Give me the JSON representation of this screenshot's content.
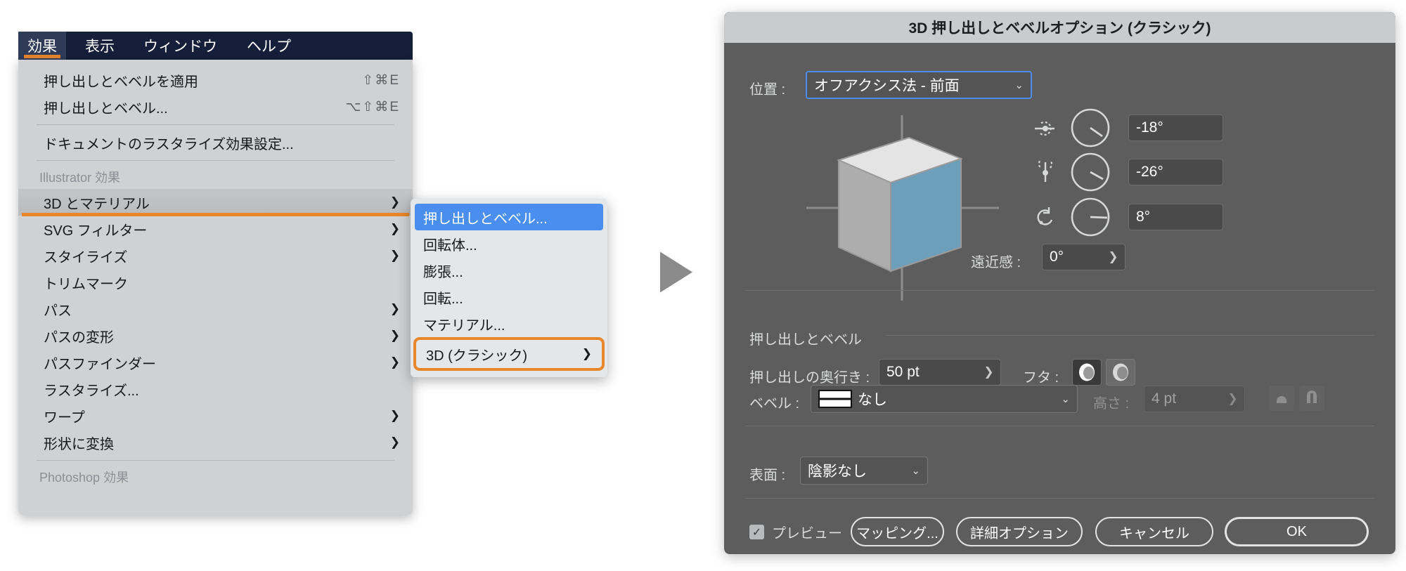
{
  "menu": {
    "bar_items": [
      {
        "label": "効果",
        "active": true
      },
      {
        "label": "表示",
        "active": false
      },
      {
        "label": "ウィンドウ",
        "active": false
      },
      {
        "label": "ヘルプ",
        "active": false
      }
    ],
    "items": [
      {
        "label": "押し出しとベベルを適用",
        "shortcut": "⇧⌘E"
      },
      {
        "label": "押し出しとベベル...",
        "shortcut": "⌥⇧⌘E"
      },
      {
        "label": "ドキュメントのラスタライズ効果設定...",
        "shortcut": ""
      },
      {
        "label": "Illustrator 効果",
        "shortcut": ""
      },
      {
        "label": "3D とマテリアル",
        "shortcut": ""
      },
      {
        "label": "SVG フィルター",
        "shortcut": ""
      },
      {
        "label": "スタイライズ",
        "shortcut": ""
      },
      {
        "label": "トリムマーク",
        "shortcut": ""
      },
      {
        "label": "パス",
        "shortcut": ""
      },
      {
        "label": "パスの変形",
        "shortcut": ""
      },
      {
        "label": "パスファインダー",
        "shortcut": ""
      },
      {
        "label": "ラスタライズ...",
        "shortcut": ""
      },
      {
        "label": "ワープ",
        "shortcut": ""
      },
      {
        "label": "形状に変換",
        "shortcut": ""
      },
      {
        "label": "Photoshop 効果",
        "shortcut": ""
      }
    ],
    "submenu_items": [
      {
        "label": "押し出しとベベル..."
      },
      {
        "label": "回転体..."
      },
      {
        "label": "膨張..."
      },
      {
        "label": "回転..."
      },
      {
        "label": "マテリアル..."
      },
      {
        "label": "3D (クラシック)"
      }
    ],
    "arrow_glyph": "❯",
    "highlight_color": "#e8862b",
    "selection_color": "#4a8ef0"
  },
  "dialog": {
    "title": "3D 押し出しとベベルオプション (クラシック)",
    "position": {
      "label": "位置 :",
      "value": "オフアクシス法 - 前面"
    },
    "angles": [
      {
        "icon": "rotate-x-icon",
        "value": "-18°",
        "dial_deg": 125
      },
      {
        "icon": "rotate-y-icon",
        "value": "-26°",
        "dial_deg": 118
      },
      {
        "icon": "rotate-z-icon",
        "value": "8°",
        "dial_deg": 92
      }
    ],
    "perspective": {
      "label": "遠近感 :",
      "value": "0°",
      "stepper": "❯"
    },
    "extrude_section": {
      "header": "押し出しとベベル",
      "depth_label": "押し出しの奥行き :",
      "depth_value": "50 pt",
      "depth_stepper": "❯",
      "cap_label": "フタ :",
      "bevel_label": "ベベル :",
      "bevel_value": "なし",
      "height_label": "高さ :",
      "height_value": "4 pt",
      "height_stepper": "❯"
    },
    "surface": {
      "label": "表面 :",
      "value": "陰影なし"
    },
    "footer": {
      "preview_label": "プレビュー",
      "preview_checked": true,
      "check_glyph": "✓",
      "mapping_label": "マッピング...",
      "advanced_label": "詳細オプション",
      "cancel_label": "キャンセル",
      "ok_label": "OK"
    },
    "cube_face_color": "#6e9fba"
  }
}
